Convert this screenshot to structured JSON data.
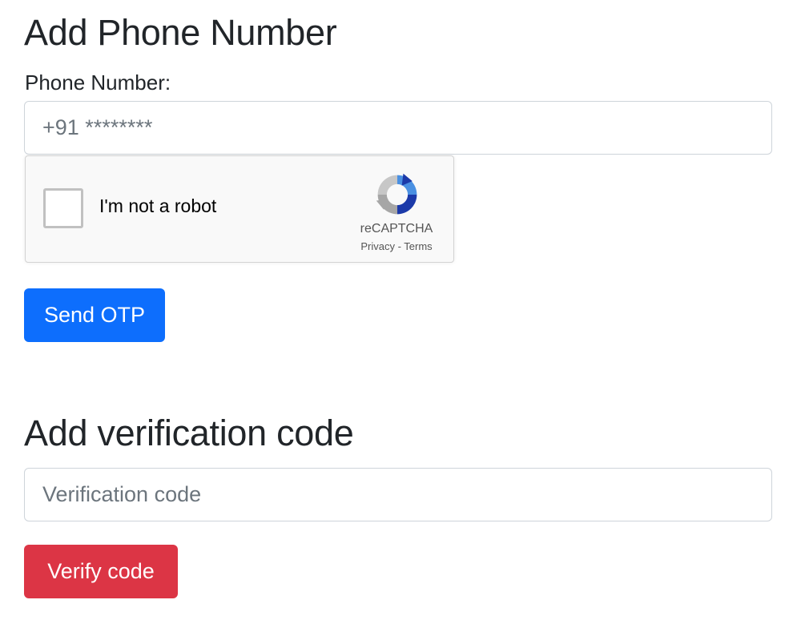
{
  "phone_section": {
    "title": "Add Phone Number",
    "label": "Phone Number:",
    "input_placeholder": "+91 ********",
    "input_value": ""
  },
  "recaptcha": {
    "checkbox_label": "I'm not a robot",
    "brand": "reCAPTCHA",
    "privacy_link": "Privacy",
    "separator": " - ",
    "terms_link": "Terms",
    "checked": false,
    "icon": "recaptcha-logo-icon"
  },
  "send_button": {
    "label": "Send OTP",
    "color": "#0d6efd"
  },
  "verify_section": {
    "title": "Add verification code",
    "input_placeholder": "Verification code",
    "input_value": ""
  },
  "verify_button": {
    "label": "Verify code",
    "color": "#dc3545"
  }
}
